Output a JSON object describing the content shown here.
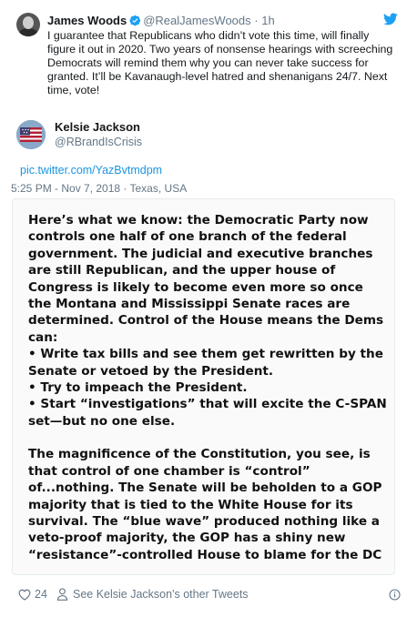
{
  "quoted_tweet": {
    "name": "James Woods",
    "handle": "@RealJamesWoods",
    "separator": "·",
    "time": "1h",
    "text": "I guarantee that Republicans who didn’t vote this time, will finally figure it out in 2020. Two years of nonsense hearings with screeching Democrats will remind them why you can never take success for granted. It’ll be Kavanaugh-level hatred and shenanigans 24/7. Next time, vote!"
  },
  "tweet": {
    "name": "Kelsie Jackson",
    "handle": "@RBrandIsCrisis",
    "link": "pic.twitter.com/YazBvtmdpm",
    "meta": "5:25 PM - Nov 7, 2018 · Texas, USA"
  },
  "image_text": {
    "para1": "Here’s what we know: the Democratic Party now controls one half of one branch of the federal government. The judicial and executive branches are still Republican, and the upper house of Congress is likely to become even more so once the Montana and Mississippi Senate races are determined. Control of the House means the Dems can:",
    "bullet1": "• Write tax bills and see them get rewritten by the Senate or vetoed by the President.",
    "bullet2": "• Try to impeach the President.",
    "bullet3": "• Start “investigations” that will excite the C-SPAN set—but no one else.",
    "para2": "The magnificence of the Constitution, you see, is that control of one chamber is “control” of...nothing. The Senate will be beholden to a GOP majority that is tied to the White House for its survival. The “blue wave” produced nothing like a veto-proof majority, the GOP has a shiny new “resistance”-controlled House to blame for the DC"
  },
  "footer": {
    "likes": "24",
    "other_tweets": "See Kelsie Jackson's other Tweets"
  },
  "colors": {
    "link": "#1b95e0",
    "muted": "#657786",
    "verified": "#1da1f2"
  }
}
